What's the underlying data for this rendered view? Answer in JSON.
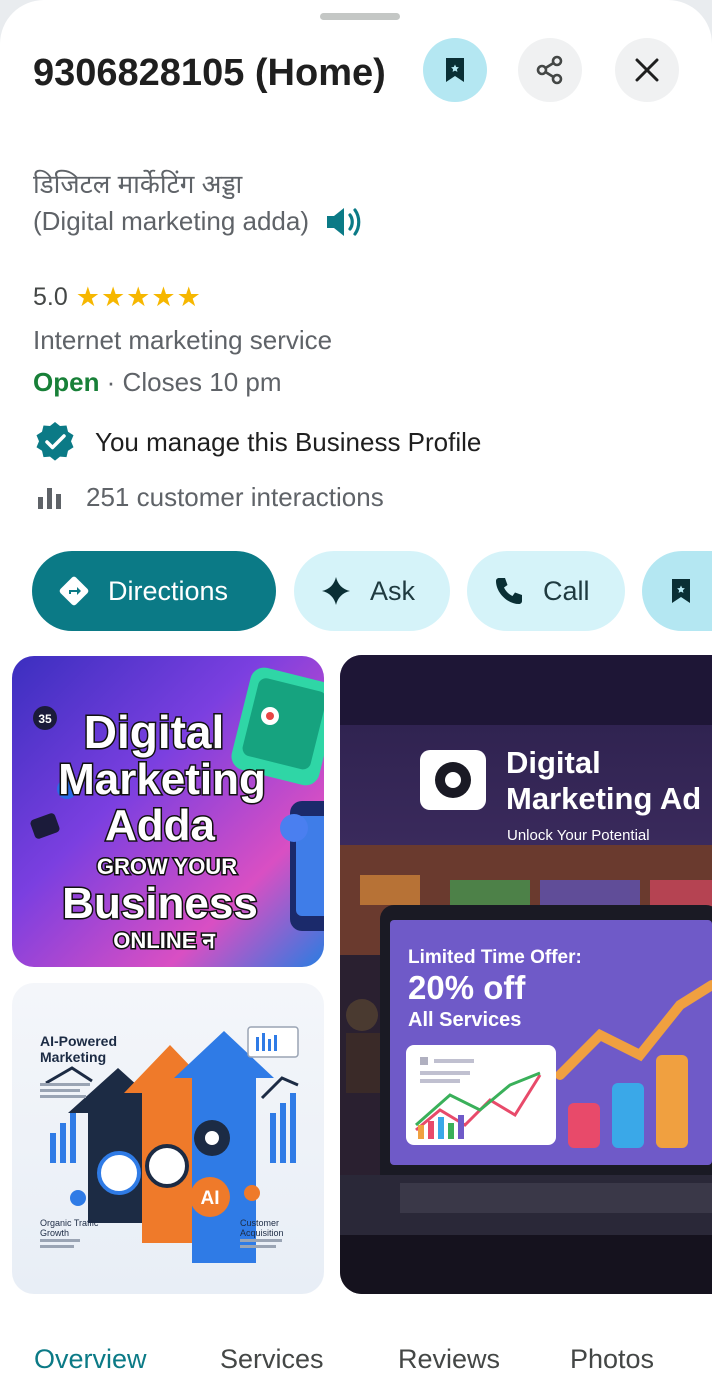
{
  "place": {
    "title": "9306828105 (Home)",
    "name_hindi": "डिजिटल मार्केटिंग अड्डा",
    "name_english": "(Digital marketing adda)",
    "rating": "5.0",
    "stars": "★★★★★",
    "category": "Internet marketing service",
    "status_open": "Open",
    "status_closes": " · Closes 10 pm",
    "manage_text": "You manage this Business Profile",
    "interactions_text": "251 customer interactions"
  },
  "actions": {
    "directions": "Directions",
    "ask": "Ask",
    "call": "Call"
  },
  "photos": {
    "p1": {
      "line1": "Digital",
      "line2": "Marketing",
      "line3": "Adda",
      "line4": "GROW YOUR",
      "line5": "Business",
      "line6": "ONLINE न",
      "badge": "35"
    },
    "p2": {
      "brand1": "Digital",
      "brand2": "Marketing Ad",
      "tagline": "Unlock Your Potential",
      "offer1": "Limited Time Offer:",
      "offer2": "20% off",
      "offer3": "All Services"
    },
    "p3": {
      "title1": "AI-Powered",
      "title2": "Marketing",
      "label_left1": "Organic Traffic",
      "label_left2": "Growth",
      "label_right1": "Customer",
      "label_right2": "Acquisition",
      "ai": "AI"
    }
  },
  "tabs": [
    "Overview",
    "Services",
    "Reviews",
    "Photos"
  ],
  "colors": {
    "accent": "#0b7a86",
    "chip_light": "#d5f3f9",
    "save_bg": "#b4e7f2",
    "open_green": "#188038",
    "star_yellow": "#f6b700"
  }
}
